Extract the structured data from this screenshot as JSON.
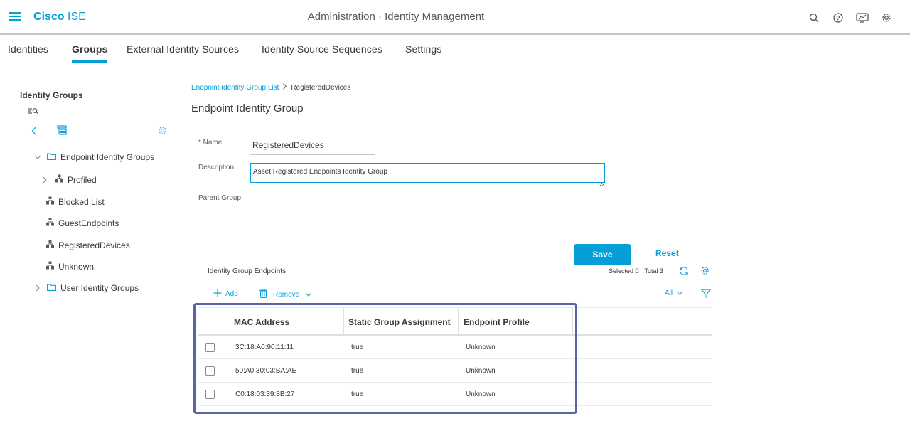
{
  "header": {
    "brand_bold": "Cisco",
    "brand_rest": " ISE",
    "page_heading": "Administration · Identity Management",
    "icons": [
      "search-icon",
      "help-icon",
      "dashboard-icon",
      "gear-icon"
    ]
  },
  "tabs": [
    {
      "label": "Identities",
      "active": false
    },
    {
      "label": "Groups",
      "active": true
    },
    {
      "label": "External Identity Sources",
      "active": false
    },
    {
      "label": "Identity Source Sequences",
      "active": false
    },
    {
      "label": "Settings",
      "active": false
    }
  ],
  "sidebar": {
    "title": "Identity Groups",
    "tree": [
      {
        "label": "Endpoint Identity Groups",
        "expanded": true,
        "icon": "folder-icon"
      },
      {
        "label": "Profiled",
        "expanded": false,
        "icon": "group-icon"
      },
      {
        "label": "Blocked List",
        "icon": "group-icon"
      },
      {
        "label": "GuestEndpoints",
        "icon": "group-icon"
      },
      {
        "label": "RegisteredDevices",
        "icon": "group-icon"
      },
      {
        "label": "Unknown",
        "icon": "group-icon"
      },
      {
        "label": "User Identity Groups",
        "expanded": false,
        "icon": "folder-icon"
      }
    ]
  },
  "breadcrumb": {
    "parent": "Endpoint Identity Group List",
    "current": "RegisteredDevices"
  },
  "form": {
    "title": "Endpoint Identity Group",
    "name_label": "* Name",
    "name_value": "RegisteredDevices",
    "description_label": "Description",
    "description_value": "Asset Registered Endpoints Identity Group",
    "parent_group_label": "Parent Group",
    "save_label": "Save",
    "reset_label": "Reset"
  },
  "endpoints": {
    "title": "Identity Group Endpoints",
    "selected_text": "Selected 0",
    "total_text": "Total 3",
    "add_label": "Add",
    "remove_label": "Remove",
    "filter_label": "All",
    "columns": [
      "MAC Address",
      "Static Group Assignment",
      "Endpoint Profile"
    ],
    "rows": [
      {
        "mac": "3C:18:A0:90:11:11",
        "static": "true",
        "profile": "Unknown"
      },
      {
        "mac": "50:A0:30:03:BA:AE",
        "static": "true",
        "profile": "Unknown"
      },
      {
        "mac": "C0:18:03:39:8B:27",
        "static": "true",
        "profile": "Unknown"
      }
    ]
  },
  "colors": {
    "accent": "#049fd9",
    "highlight": "#5b63a6"
  }
}
